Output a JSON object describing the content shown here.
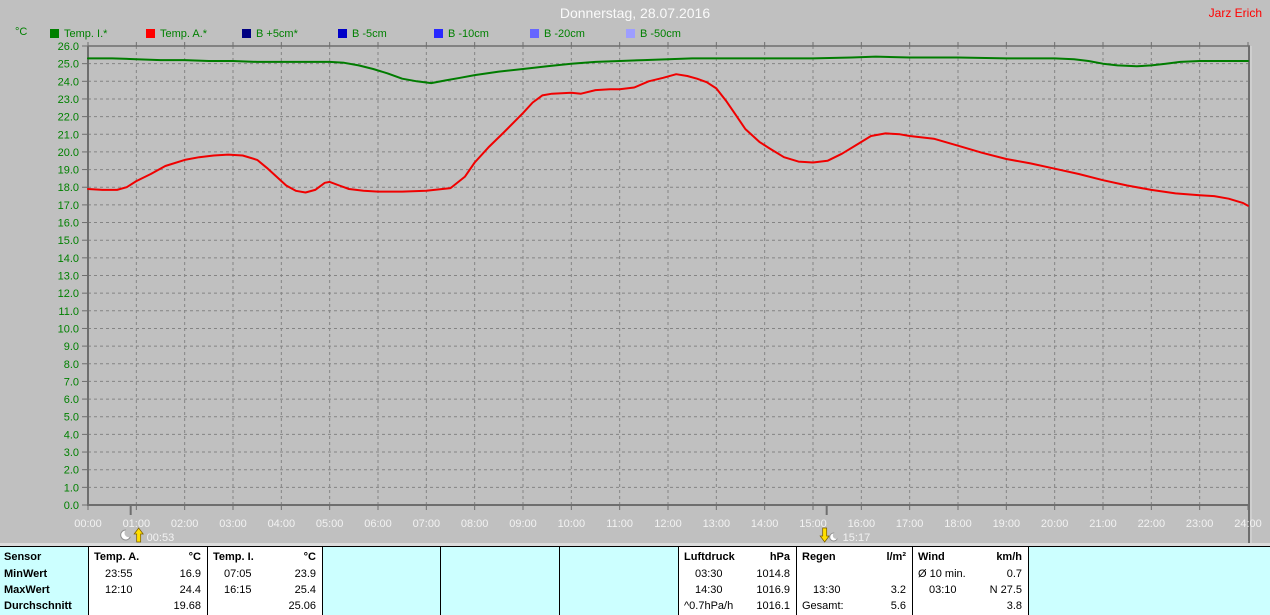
{
  "header": {
    "title": "Donnerstag, 28.07.2016",
    "author": "Jarz Erich"
  },
  "legend": {
    "unit": "°C",
    "items": [
      {
        "label": "Temp. I.*",
        "color": "#008000"
      },
      {
        "label": "Temp. A.*",
        "color": "#ff0000"
      },
      {
        "label": "B +5cm*",
        "color": "#000082"
      },
      {
        "label": "B -5cm",
        "color": "#0000c8"
      },
      {
        "label": "B -10cm",
        "color": "#2828ff"
      },
      {
        "label": "B -20cm",
        "color": "#6666ff"
      },
      {
        "label": "B -50cm",
        "color": "#9e9eff"
      }
    ]
  },
  "chart_data": {
    "type": "line",
    "title": "Donnerstag, 28.07.2016",
    "ylabel": "°C",
    "ylim": [
      0,
      26
    ],
    "xlim_hours": [
      0,
      24
    ],
    "grid": "dashed",
    "legend_position": "top",
    "x_tick_labels": [
      "00:00",
      "01:00",
      "02:00",
      "03:00",
      "04:00",
      "05:00",
      "06:00",
      "07:00",
      "08:00",
      "09:00",
      "10:00",
      "11:00",
      "12:00",
      "13:00",
      "14:00",
      "15:00",
      "16:00",
      "17:00",
      "18:00",
      "19:00",
      "20:00",
      "21:00",
      "22:00",
      "23:00",
      "24:00"
    ],
    "y_tick_labels": [
      "26.0",
      "25.0",
      "24.0",
      "23.0",
      "22.0",
      "21.0",
      "20.0",
      "19.0",
      "18.0",
      "17.0",
      "16.0",
      "15.0",
      "14.0",
      "13.0",
      "12.0",
      "11.0",
      "10.0",
      "9.0",
      "8.0",
      "7.0",
      "6.0",
      "5.0",
      "4.0",
      "3.0",
      "2.0",
      "1.0",
      "0.0"
    ],
    "series": [
      {
        "name": "Temp. I.*",
        "color": "#007c00",
        "points": [
          [
            0,
            25.3
          ],
          [
            0.5,
            25.3
          ],
          [
            1,
            25.25
          ],
          [
            1.5,
            25.2
          ],
          [
            2,
            25.2
          ],
          [
            2.5,
            25.15
          ],
          [
            3,
            25.15
          ],
          [
            3.5,
            25.1
          ],
          [
            4,
            25.1
          ],
          [
            4.5,
            25.1
          ],
          [
            5,
            25.1
          ],
          [
            5.3,
            25.05
          ],
          [
            5.6,
            24.9
          ],
          [
            5.9,
            24.7
          ],
          [
            6.2,
            24.45
          ],
          [
            6.5,
            24.15
          ],
          [
            6.8,
            24.0
          ],
          [
            7.1,
            23.9
          ],
          [
            7.4,
            24.05
          ],
          [
            7.7,
            24.2
          ],
          [
            8,
            24.35
          ],
          [
            8.5,
            24.55
          ],
          [
            9,
            24.7
          ],
          [
            9.5,
            24.85
          ],
          [
            10,
            25.0
          ],
          [
            10.5,
            25.1
          ],
          [
            11,
            25.15
          ],
          [
            11.5,
            25.2
          ],
          [
            12,
            25.25
          ],
          [
            12.5,
            25.3
          ],
          [
            13,
            25.3
          ],
          [
            14,
            25.3
          ],
          [
            15,
            25.3
          ],
          [
            15.8,
            25.35
          ],
          [
            16.3,
            25.4
          ],
          [
            17,
            25.35
          ],
          [
            18,
            25.35
          ],
          [
            19,
            25.3
          ],
          [
            20,
            25.3
          ],
          [
            20.4,
            25.25
          ],
          [
            20.7,
            25.15
          ],
          [
            21,
            25.0
          ],
          [
            21.3,
            24.9
          ],
          [
            21.7,
            24.85
          ],
          [
            22,
            24.9
          ],
          [
            22.3,
            25.0
          ],
          [
            22.6,
            25.1
          ],
          [
            23,
            25.15
          ],
          [
            23.5,
            25.15
          ],
          [
            24,
            25.15
          ]
        ]
      },
      {
        "name": "Temp. A.*",
        "color": "#f00000",
        "points": [
          [
            0,
            17.9
          ],
          [
            0.3,
            17.85
          ],
          [
            0.6,
            17.85
          ],
          [
            0.8,
            18.0
          ],
          [
            1,
            18.35
          ],
          [
            1.3,
            18.75
          ],
          [
            1.6,
            19.2
          ],
          [
            2,
            19.55
          ],
          [
            2.3,
            19.7
          ],
          [
            2.6,
            19.8
          ],
          [
            2.9,
            19.85
          ],
          [
            3.2,
            19.8
          ],
          [
            3.5,
            19.55
          ],
          [
            3.7,
            19.1
          ],
          [
            3.9,
            18.6
          ],
          [
            4.1,
            18.1
          ],
          [
            4.3,
            17.8
          ],
          [
            4.5,
            17.7
          ],
          [
            4.7,
            17.85
          ],
          [
            4.9,
            18.25
          ],
          [
            5,
            18.3
          ],
          [
            5.2,
            18.1
          ],
          [
            5.4,
            17.9
          ],
          [
            5.7,
            17.8
          ],
          [
            6,
            17.75
          ],
          [
            6.5,
            17.75
          ],
          [
            7,
            17.8
          ],
          [
            7.5,
            17.95
          ],
          [
            7.8,
            18.6
          ],
          [
            8,
            19.4
          ],
          [
            8.3,
            20.3
          ],
          [
            8.6,
            21.1
          ],
          [
            9,
            22.2
          ],
          [
            9.2,
            22.8
          ],
          [
            9.4,
            23.2
          ],
          [
            9.6,
            23.3
          ],
          [
            10,
            23.35
          ],
          [
            10.2,
            23.3
          ],
          [
            10.5,
            23.5
          ],
          [
            10.8,
            23.55
          ],
          [
            11,
            23.55
          ],
          [
            11.3,
            23.65
          ],
          [
            11.6,
            24.0
          ],
          [
            11.9,
            24.2
          ],
          [
            12.17,
            24.4
          ],
          [
            12.4,
            24.3
          ],
          [
            12.6,
            24.15
          ],
          [
            12.8,
            23.95
          ],
          [
            13,
            23.6
          ],
          [
            13.2,
            22.9
          ],
          [
            13.4,
            22.1
          ],
          [
            13.6,
            21.3
          ],
          [
            13.9,
            20.55
          ],
          [
            14.1,
            20.2
          ],
          [
            14.4,
            19.7
          ],
          [
            14.7,
            19.45
          ],
          [
            15,
            19.4
          ],
          [
            15.3,
            19.5
          ],
          [
            15.6,
            19.9
          ],
          [
            15.9,
            20.4
          ],
          [
            16.2,
            20.9
          ],
          [
            16.5,
            21.05
          ],
          [
            16.8,
            21.0
          ],
          [
            17,
            20.9
          ],
          [
            17.5,
            20.75
          ],
          [
            18,
            20.35
          ],
          [
            18.5,
            19.95
          ],
          [
            19,
            19.6
          ],
          [
            19.5,
            19.35
          ],
          [
            20,
            19.05
          ],
          [
            20.5,
            18.75
          ],
          [
            21,
            18.4
          ],
          [
            21.5,
            18.1
          ],
          [
            22,
            17.85
          ],
          [
            22.5,
            17.65
          ],
          [
            23,
            17.55
          ],
          [
            23.3,
            17.5
          ],
          [
            23.6,
            17.35
          ],
          [
            23.9,
            17.1
          ],
          [
            24,
            16.95
          ]
        ]
      }
    ],
    "markers": [
      {
        "name": "moonrise",
        "time": "00:53",
        "hour": 0.883,
        "direction": "up"
      },
      {
        "name": "moonset",
        "time": "15:17",
        "hour": 15.283,
        "direction": "down"
      }
    ]
  },
  "table": {
    "row_labels": [
      "Sensor",
      "MinWert",
      "MaxWert",
      "Durchschnitt"
    ],
    "columns": [
      {
        "name": "Temp. A.",
        "unit": "°C",
        "cells": [
          [
            "23:55",
            "16.9"
          ],
          [
            "12:10",
            "24.4"
          ],
          [
            "",
            "19.68"
          ]
        ]
      },
      {
        "name": "Temp. I.",
        "unit": "°C",
        "cells": [
          [
            "07:05",
            "23.9"
          ],
          [
            "16:15",
            "25.4"
          ],
          [
            "",
            "25.06"
          ]
        ]
      },
      {
        "name": "",
        "unit": "",
        "cells": [
          [
            "",
            ""
          ],
          [
            "",
            ""
          ],
          [
            "",
            ""
          ]
        ]
      },
      {
        "name": "",
        "unit": "",
        "cells": [
          [
            "",
            ""
          ],
          [
            "",
            ""
          ],
          [
            "",
            ""
          ]
        ]
      },
      {
        "name": "",
        "unit": "",
        "cells": [
          [
            "",
            ""
          ],
          [
            "",
            ""
          ],
          [
            "",
            ""
          ]
        ]
      },
      {
        "name": "Luftdruck",
        "unit": "hPa",
        "cells": [
          [
            "03:30",
            "1014.8"
          ],
          [
            "14:30",
            "1016.9"
          ],
          [
            "^0.7hPa/h",
            "1016.1"
          ]
        ]
      },
      {
        "name": "Regen",
        "unit": "l/m²",
        "cells": [
          [
            "",
            ""
          ],
          [
            "13:30",
            "3.2"
          ],
          [
            "Gesamt:",
            "5.6"
          ]
        ]
      },
      {
        "name": "Wind",
        "unit": "km/h",
        "cells": [
          [
            "Ø 10 min.",
            "0.7"
          ],
          [
            "03:10",
            "N 27.5"
          ],
          [
            "",
            "3.8"
          ]
        ]
      }
    ]
  },
  "colors": {
    "background": "#c0c0c0",
    "plot_grid": "#848484",
    "plot_axis": "#6e6e6e",
    "x_tick_text": "#f2f2f2",
    "y_tick_text": "#008000",
    "title_text": "#fafafa",
    "author_text": "#ff0000",
    "table_bg": "#ccffff",
    "table_cell_bg": "#ffffff",
    "table_text": "#000000",
    "marker_label": "#f2f2f2",
    "marker_arrow": "#ffdf00"
  }
}
